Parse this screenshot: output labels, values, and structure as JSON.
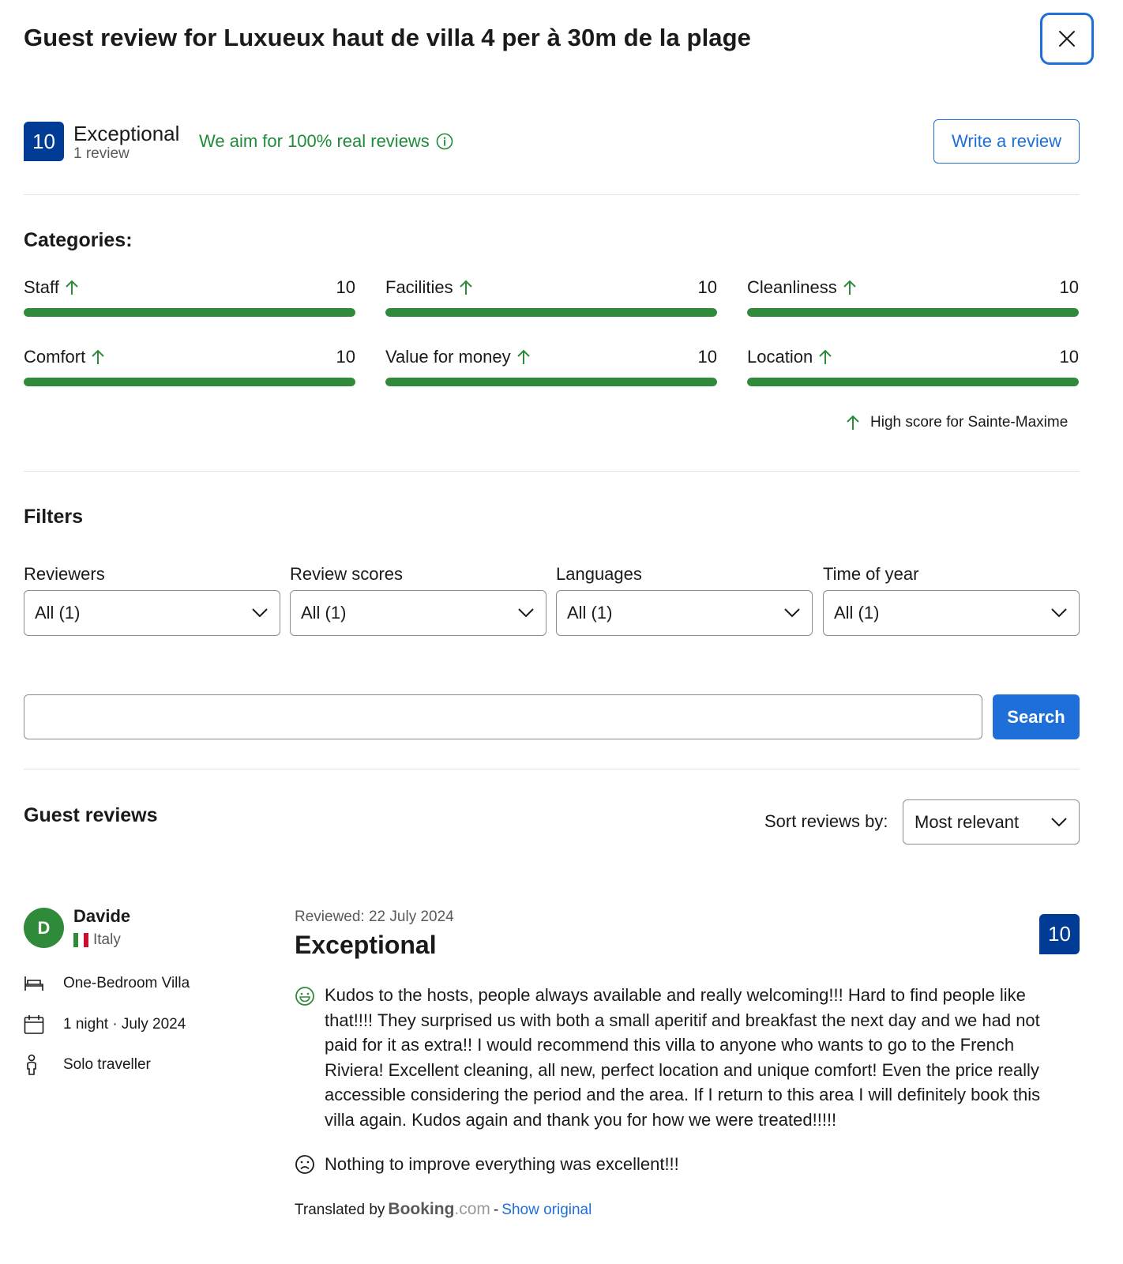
{
  "header": {
    "title": "Guest review for Luxueux haut de villa 4 per à 30m de la plage",
    "close_icon": "close-icon"
  },
  "score": {
    "value": "10",
    "word": "Exceptional",
    "count": "1 review",
    "real_reviews_text": "We aim for 100% real reviews",
    "write_review_label": "Write a review"
  },
  "categories": {
    "heading": "Categories:",
    "items": [
      {
        "label": "Staff",
        "score": "10",
        "fraction": 1.0
      },
      {
        "label": "Facilities",
        "score": "10",
        "fraction": 1.0
      },
      {
        "label": "Cleanliness",
        "score": "10",
        "fraction": 1.0
      },
      {
        "label": "Comfort",
        "score": "10",
        "fraction": 1.0
      },
      {
        "label": "Value for money",
        "score": "10",
        "fraction": 1.0
      },
      {
        "label": "Location",
        "score": "10",
        "fraction": 1.0
      }
    ],
    "high_score_text": "High score for Sainte-Maxime"
  },
  "filters": {
    "heading": "Filters",
    "items": [
      {
        "label": "Reviewers",
        "value": "All (1)"
      },
      {
        "label": "Review scores",
        "value": "All (1)"
      },
      {
        "label": "Languages",
        "value": "All (1)"
      },
      {
        "label": "Time of year",
        "value": "All (1)"
      }
    ],
    "search_value": "",
    "search_label": "Search"
  },
  "guest_reviews": {
    "heading": "Guest reviews",
    "sort_label": "Sort reviews by:",
    "sort_value": "Most relevant"
  },
  "review": {
    "initial": "D",
    "name": "Davide",
    "country": "Italy",
    "room": "One-Bedroom Villa",
    "stay": "1 night · July 2024",
    "traveller_type": "Solo traveller",
    "reviewed_date": "Reviewed: 22 July 2024",
    "title": "Exceptional",
    "score": "10",
    "positive_lines": [
      "Kudos to the hosts, people always available and really welcoming!!! Hard to find people like",
      "that!!!! They surprised us with both a small aperitif and breakfast the next day and we had not",
      "paid for it as extra!! I would recommend this villa to anyone who wants to go to the French",
      "Riviera! Excellent cleaning, all new, perfect location and unique comfort! Even the price really",
      "accessible considering the period and the area. If I return to this area I will definitely book this",
      "villa again. Kudos again and thank you for how we were treated!!!!!"
    ],
    "negative": "Nothing to improve everything was excellent!!!",
    "translated_by": "Translated by",
    "booking_brand": "Booking",
    "booking_suffix": ".com",
    "separator": "-",
    "show_original": "Show original"
  },
  "colors": {
    "brand_blue": "#003b95",
    "action_blue": "#1e6fd9",
    "green": "#2f8a3a"
  }
}
